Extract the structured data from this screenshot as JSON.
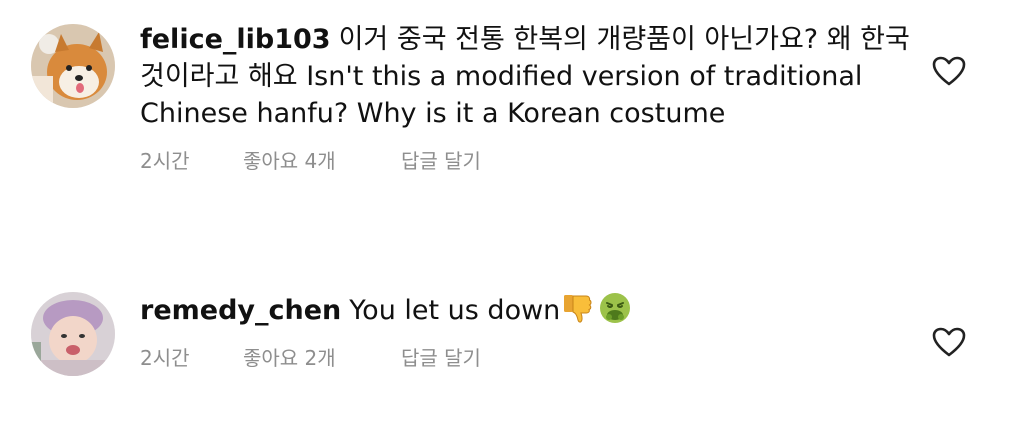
{
  "comments": [
    {
      "username": "felice_lib103",
      "text": "이거 중국 전통 한복의 개량품이 아닌가요? 왜 한국것이라고 해요  Isn't this a modified version of traditional Chinese hanfu? Why is it a Korean costume",
      "time": "2시간",
      "likes": "좋아요 4개",
      "reply": "답글 달기",
      "avatar": "shiba-dog-avatar"
    },
    {
      "username": "remedy_chen",
      "text": "You let us down",
      "emoji": [
        "thumbs-down-emoji",
        "nauseated-face-emoji"
      ],
      "time": "2시간",
      "likes": "좋아요 2개",
      "reply": "답글 달기",
      "avatar": "baby-avatar"
    }
  ],
  "icons": {
    "like": "heart-outline-icon"
  },
  "colors": {
    "text": "#111111",
    "meta": "#8e8e8e",
    "background": "#ffffff"
  }
}
